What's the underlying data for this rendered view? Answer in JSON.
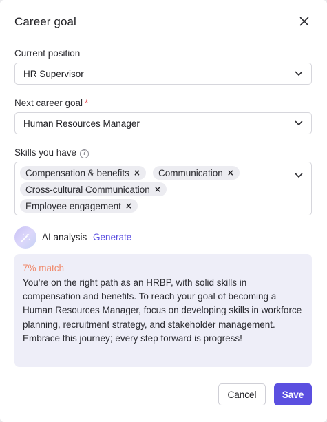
{
  "dialog": {
    "title": "Career goal",
    "close_icon": "close-icon"
  },
  "current_position": {
    "label": "Current position",
    "value": "HR Supervisor"
  },
  "next_goal": {
    "label": "Next career goal",
    "required_mark": "*",
    "value": "Human Resources Manager"
  },
  "skills": {
    "label": "Skills you have",
    "help_glyph": "?",
    "chips": [
      {
        "label": "Compensation & benefits",
        "remove": "×"
      },
      {
        "label": "Communication",
        "remove": "×"
      },
      {
        "label": "Cross-cultural Communication",
        "remove": "×"
      },
      {
        "label": "Employee engagement",
        "remove": "×"
      }
    ]
  },
  "ai": {
    "label": "AI analysis",
    "generate_label": "Generate",
    "match": "7% match",
    "text": "You're on the right path as an HRBP, with solid skills in compensation and benefits. To reach your goal of becoming a Human Resources Manager, focus on developing skills in workforce planning, recruitment strategy, and stakeholder management. Embrace this journey; every step forward is progress!"
  },
  "actions": {
    "cancel_label": "Cancel",
    "save_label": "Save"
  },
  "colors": {
    "accent": "#5b4fe0",
    "required": "#e5484d",
    "match": "#f0896b",
    "analysis_bg": "#eeeef8",
    "chip_bg": "#ececf1"
  }
}
